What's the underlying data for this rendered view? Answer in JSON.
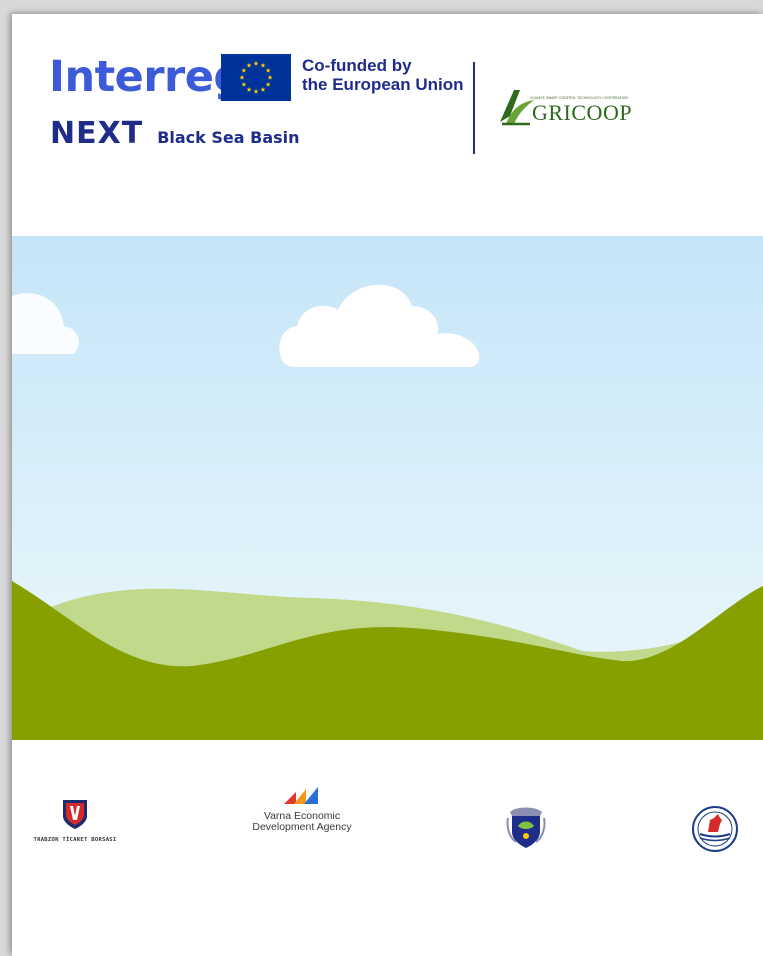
{
  "header": {
    "interreg": "Interreg",
    "next": "NEXT",
    "black_sea_basin": "Black Sea Basin",
    "cofunded_line1": "Co-funded by",
    "cofunded_line2": "the European Union",
    "agricoop_wordmark": "GRICOOP",
    "agricoop_tagline": "CLIMATE SMART CONTROL TECHNOLOGY COOPERATION"
  },
  "footer": {
    "partner1_label": "TRABZON TİCARET BORSASI",
    "partner2_line1": "Varna Economic",
    "partner2_line2": "Development Agency"
  },
  "colors": {
    "interreg_blue": "#3b5bd9",
    "navy": "#1f2d8a",
    "eu_blue": "#003399",
    "eu_star": "#ffcc00",
    "agricoop_green": "#2e6b1e",
    "sky_top": "#c5e5f8",
    "sky_bottom": "#eaf7fb",
    "hill_light": "#c1d98a",
    "hill_dark": "#86a000"
  }
}
